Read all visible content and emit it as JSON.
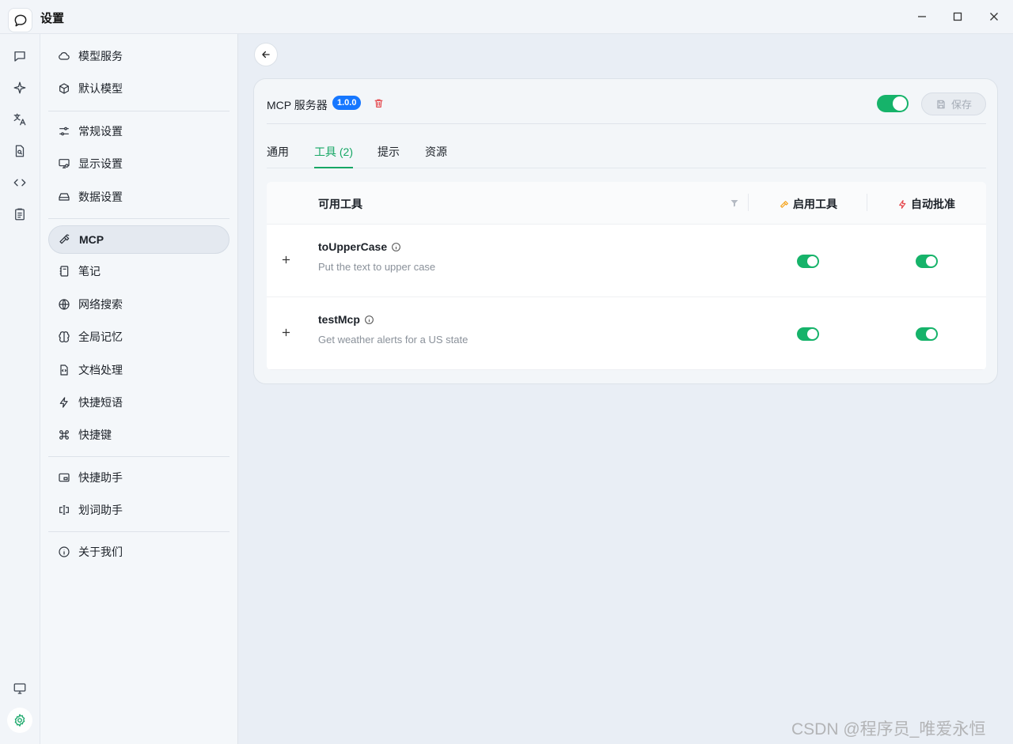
{
  "window": {
    "title": "设置"
  },
  "rail": {
    "icons": [
      "chat-bubble-icon",
      "sparkle-icon",
      "translate-icon",
      "file-search-icon",
      "code-icon",
      "clipboard-icon",
      "monitor-icon",
      "settings-gear-icon"
    ]
  },
  "sidebar": {
    "groups": [
      [
        {
          "label": "模型服务",
          "icon": "cloud-icon"
        },
        {
          "label": "默认模型",
          "icon": "cube-icon"
        }
      ],
      [
        {
          "label": "常规设置",
          "icon": "sliders-icon"
        },
        {
          "label": "显示设置",
          "icon": "display-settings-icon"
        },
        {
          "label": "数据设置",
          "icon": "hard-drive-icon"
        }
      ],
      [
        {
          "label": "MCP",
          "icon": "hammer-icon",
          "active": true
        },
        {
          "label": "笔记",
          "icon": "notebook-icon"
        },
        {
          "label": "网络搜索",
          "icon": "globe-icon"
        },
        {
          "label": "全局记忆",
          "icon": "brain-icon"
        },
        {
          "label": "文档处理",
          "icon": "file-code-icon"
        },
        {
          "label": "快捷短语",
          "icon": "zap-icon"
        },
        {
          "label": "快捷键",
          "icon": "command-icon"
        }
      ],
      [
        {
          "label": "快捷助手",
          "icon": "app-window-icon"
        },
        {
          "label": "划词助手",
          "icon": "text-cursor-icon"
        }
      ],
      [
        {
          "label": "关于我们",
          "icon": "info-icon"
        }
      ]
    ]
  },
  "server": {
    "title": "MCP 服务器",
    "version": "1.0.0",
    "enabled": true,
    "save_label": "保存"
  },
  "tabs": [
    {
      "label": "通用",
      "active": false
    },
    {
      "label": "工具 (2)",
      "active": true
    },
    {
      "label": "提示",
      "active": false
    },
    {
      "label": "资源",
      "active": false
    }
  ],
  "table": {
    "headers": {
      "tools": "可用工具",
      "enable": "启用工具",
      "auto_approve": "自动批准"
    },
    "header_colors": {
      "enable_icon": "#f5a623",
      "auto_approve_icon": "#e5484d"
    },
    "rows": [
      {
        "name": "toUpperCase",
        "desc": "Put the text to upper case",
        "enabled": true,
        "auto_approve": true
      },
      {
        "name": "testMcp",
        "desc": "Get weather alerts for a US state",
        "enabled": true,
        "auto_approve": true
      }
    ]
  },
  "watermark": "CSDN @程序员_唯爱永恒",
  "colors": {
    "accent": "#16b36a",
    "badge": "#1677ff",
    "danger": "#e5484d"
  }
}
